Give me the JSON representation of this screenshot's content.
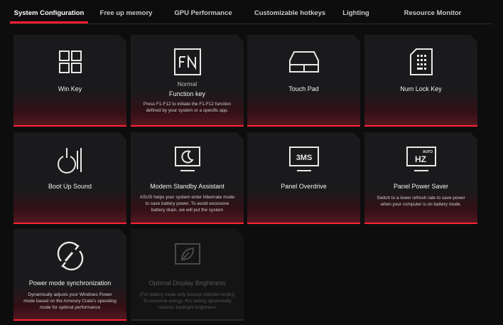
{
  "tabs": [
    {
      "label": "System Configuration",
      "active": true
    },
    {
      "label": "Free up memory"
    },
    {
      "label": "GPU Performance"
    },
    {
      "label": "Customizable hotkeys"
    },
    {
      "label": "Lighting"
    },
    {
      "label": "Resource Monitor"
    }
  ],
  "cards": {
    "win_key": {
      "title": "Win Key",
      "icon": "windows-grid-icon"
    },
    "function_key": {
      "status": "Normal",
      "title": "Function key",
      "icon": "fn-key-icon",
      "description": "Press F1-F12 to initiate the F1-F12 function defined by your system or a specific app."
    },
    "touch_pad": {
      "title": "Touch Pad",
      "icon": "touchpad-icon"
    },
    "num_lock_key": {
      "title": "Num Lock Key",
      "icon": "numpad-icon"
    },
    "boot_up_sound": {
      "title": "Boot Up Sound",
      "icon": "boot-sound-icon"
    },
    "modern_standby": {
      "title": "Modern Standby Assistant",
      "icon": "standby-moon-icon",
      "description": "ASUS helps your system enter hibernate mode to save battery power. To avoid excessive battery drain, we will put the system"
    },
    "panel_overdrive": {
      "title": "Panel Overdrive",
      "icon": "overdrive-3ms-icon"
    },
    "panel_power_saver": {
      "title": "Panel Power Saver",
      "icon": "auto-hz-icon",
      "description": "Switch to a lower refresh rate to save power when your computer is on battery mode."
    },
    "power_mode_sync": {
      "title": "Power mode synchronization",
      "icon": "power-sync-icon",
      "description": "Dynamically adjusts your Windows Power mode based on the Armoury Crate's operating mode for optimal performance"
    },
    "optimal_display_brightness": {
      "title": "Optimal Display Brightness",
      "icon": "leaf-display-icon",
      "enabled": false,
      "description": "[For battery mode only (except ultimate mode)] To conserve energy, this setting dynamically reduces backlight brightness"
    }
  },
  "colors": {
    "accent": "#ff1e2d",
    "card_bg": "#1a1a1c",
    "background": "#0d0d0e"
  }
}
